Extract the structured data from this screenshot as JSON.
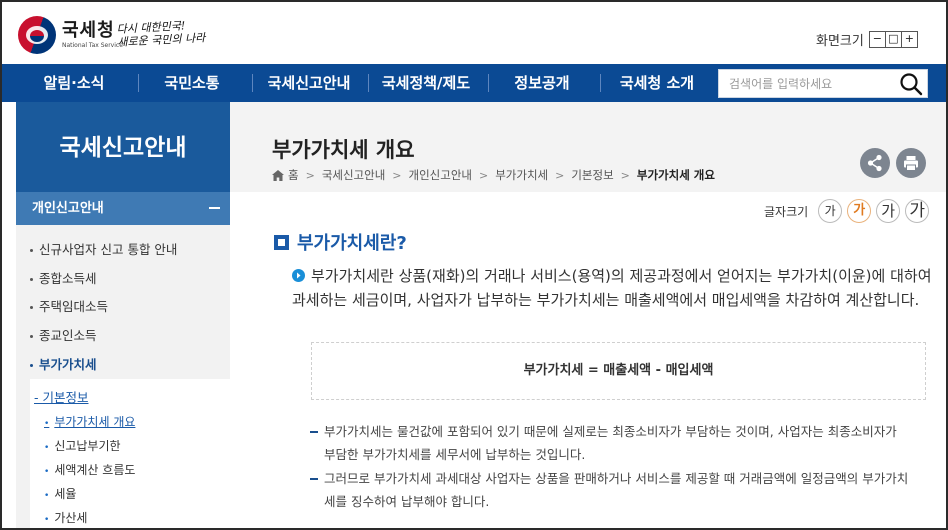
{
  "header": {
    "logo_kr": "국세청",
    "logo_en": "National Tax Service",
    "slogan_line1": "다시 대한민국!",
    "slogan_line2": "새로운 국민의 나라",
    "screen_size_label": "화면크기",
    "screen_size_minus": "−",
    "screen_size_reset": "□",
    "screen_size_plus": "+"
  },
  "gnb": {
    "items": [
      "알림·소식",
      "국민소통",
      "국세신고안내",
      "국세정책/제도",
      "정보공개",
      "국세청 소개"
    ],
    "search_placeholder": "검색어를 입력하세요"
  },
  "lnb": {
    "title": "국세신고안내",
    "category": "개인신고안내",
    "items": [
      "신규사업자 신고 통합 안내",
      "종합소득세",
      "주택임대소득",
      "종교인소득",
      "부가가치세"
    ],
    "active_item": "부가가치세",
    "sub_head": "기본정보",
    "sub_items": [
      "부가가치세 개요",
      "신고납부기한",
      "세액계산 흐름도",
      "세율",
      "가산세"
    ],
    "current_sub_item": "부가가치세 개요"
  },
  "content": {
    "page_title": "부가가치세 개요",
    "breadcrumb": [
      "홈",
      "국세신고안내",
      "개인신고안내",
      "부가가치세",
      "기본정보",
      "부가가치세 개요"
    ],
    "font_size_label": "글자크기",
    "font_size_buttons": [
      "가",
      "가",
      "가",
      "가"
    ],
    "section_title": "부가가치세란?",
    "description": "부가가치세란 상품(재화)의 거래나 서비스(용역)의 제공과정에서 얻어지는 부가가치(이윤)에 대하여 과세하는 세금이며, 사업자가 납부하는 부가가치세는 매출세액에서 매입세액을 차감하여 계산합니다.",
    "formula": "부가가치세 = 매출세액 - 매입세액",
    "notes": [
      "부가가치세는 물건값에 포함되어 있기 때문에 실제로는 최종소비자가 부담하는 것이며, 사업자는 최종소비자가 부담한 부가가치세를 세무서에 납부하는 것입니다.",
      "그러므로 부가가치세 과세대상 사업자는 상품을 판매하거나 서비스를 제공할 때 거래금액에 일정금액의 부가가치세를 징수하여 납부해야 합니다."
    ]
  },
  "colors": {
    "gnb_bg": "#0b4a94",
    "lnb_title_bg": "#1a5a9c",
    "lnb_category_bg": "#3f7ab4",
    "accent_blue": "#1a5aa8",
    "accent_orange": "#e07a1f"
  },
  "icons": [
    "search-icon",
    "home-icon",
    "share-icon",
    "print-icon",
    "circle-arrow-icon",
    "minus-icon"
  ]
}
